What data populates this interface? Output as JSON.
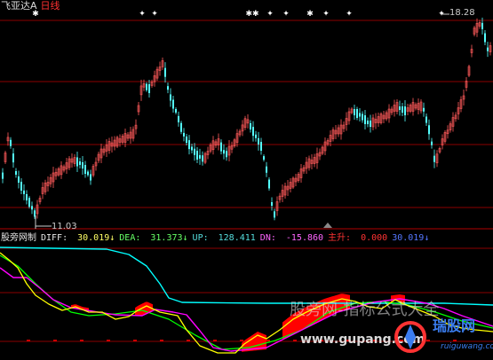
{
  "header": {
    "title": "飞亚达A",
    "period": "日线"
  },
  "price_panel": {
    "high_label": "18.28",
    "low_label": "11.03",
    "marker_glyphs": [
      "✱",
      "✦",
      "✦",
      "✱✱",
      "✦",
      "✦",
      "✱",
      "✦",
      "✦",
      "✦"
    ]
  },
  "indicator": {
    "name": "股旁网制",
    "diff_label": "DIFF: ",
    "diff_value": "30.019↓",
    "dea_label": "DEA: ",
    "dea_value": "31.373↓",
    "up_label": "UP: ",
    "up_value": "128.411",
    "dn_label": "DN: ",
    "dn_value": "-15.860",
    "main_label": "主升: ",
    "main_value": "0.000",
    "last_value": "30.019↓"
  },
  "watermark": {
    "line1": "股旁网-指标公式大全",
    "line2": "www.gupang.com",
    "brand": "瑞股网",
    "brand_url": "ruiguwang.com"
  },
  "colors": {
    "background": "#000000",
    "grid": "#8b0000",
    "up_candle": "#ff5a5a",
    "down_candle": "#54ffff",
    "diff": "#ffff00",
    "dea": "#ff00ff",
    "up": "#00cccc",
    "dn": "#00ff00",
    "main_rise": "#ff0000",
    "teal": "#00ffff"
  },
  "chart_data": {
    "type": "candlestick",
    "price_extremes": {
      "high": 18.28,
      "low": 11.03
    },
    "indicator_values": {
      "DIFF": 30.019,
      "DEA": 31.373,
      "UP": 128.411,
      "DN": -15.86,
      "主升": 0.0
    }
  }
}
